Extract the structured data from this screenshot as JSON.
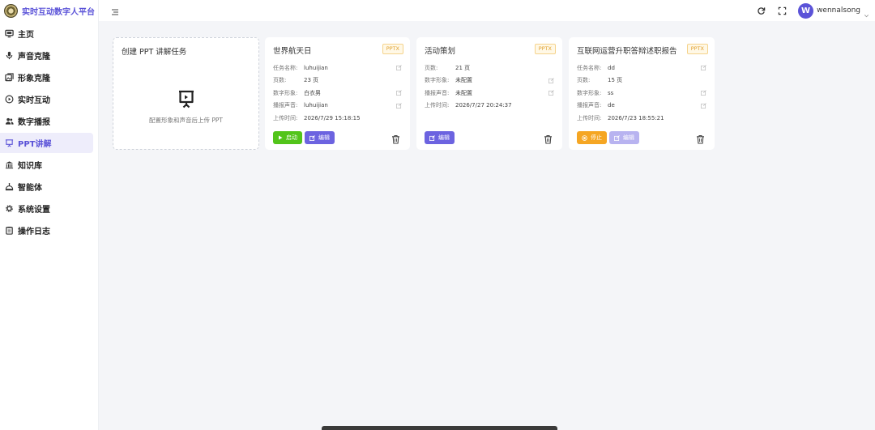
{
  "app": {
    "title": "实时互动数字人平台"
  },
  "sidebar": {
    "items": [
      {
        "label": "主页",
        "icon": "monitor-icon"
      },
      {
        "label": "声音克隆",
        "icon": "microphone-icon"
      },
      {
        "label": "形象克隆",
        "icon": "image-stack-icon"
      },
      {
        "label": "实时互动",
        "icon": "play-circle-icon"
      },
      {
        "label": "数字播报",
        "icon": "users-icon"
      },
      {
        "label": "PPT讲解",
        "icon": "presentation-icon",
        "active": true
      },
      {
        "label": "知识库",
        "icon": "bank-icon"
      },
      {
        "label": "智能体",
        "icon": "robot-icon"
      },
      {
        "label": "系统设置",
        "icon": "gear-icon"
      },
      {
        "label": "操作日志",
        "icon": "clipboard-icon"
      }
    ]
  },
  "header": {
    "user_initial": "W",
    "username": "wennalsong"
  },
  "create_card": {
    "title": "创建 PPT 讲解任务",
    "hint": "配置形象和声音后上传 PPT"
  },
  "tasks": [
    {
      "title": "世界航天日",
      "badge": "PPTX",
      "rows": [
        {
          "label": "任务名称:",
          "value": "luhuijian"
        },
        {
          "label": "页数:",
          "value": "23 页"
        },
        {
          "label": "数字形象:",
          "value": "白衣男"
        },
        {
          "label": "播报声音:",
          "value": "luhuijian"
        },
        {
          "label": "上传时间:",
          "value": "2026/7/29 15:18:15"
        }
      ],
      "primary_label": "启动",
      "edit_label": "编辑"
    },
    {
      "title": "活动策划",
      "badge": "PPTX",
      "rows": [
        {
          "label": "页数:",
          "value": "21 页"
        },
        {
          "label": "数字形象:",
          "value": "未配置"
        },
        {
          "label": "播报声音:",
          "value": "未配置"
        },
        {
          "label": "上传时间:",
          "value": "2026/7/27 20:24:37"
        }
      ],
      "edit_label": "编辑"
    },
    {
      "title": "互联网运营升职答辩述职报告",
      "badge": "PPTX",
      "rows": [
        {
          "label": "任务名称:",
          "value": "dd"
        },
        {
          "label": "页数:",
          "value": "15 页"
        },
        {
          "label": "数字形象:",
          "value": "ss"
        },
        {
          "label": "播报声音:",
          "value": "de"
        },
        {
          "label": "上传时间:",
          "value": "2026/7/23 18:55:21"
        }
      ],
      "primary_label": "停止",
      "edit_label": "编辑"
    }
  ],
  "colors": {
    "accent": "#5b53d8",
    "start": "#52c41a",
    "stop": "#f5a623",
    "badge": "#e0a030"
  }
}
